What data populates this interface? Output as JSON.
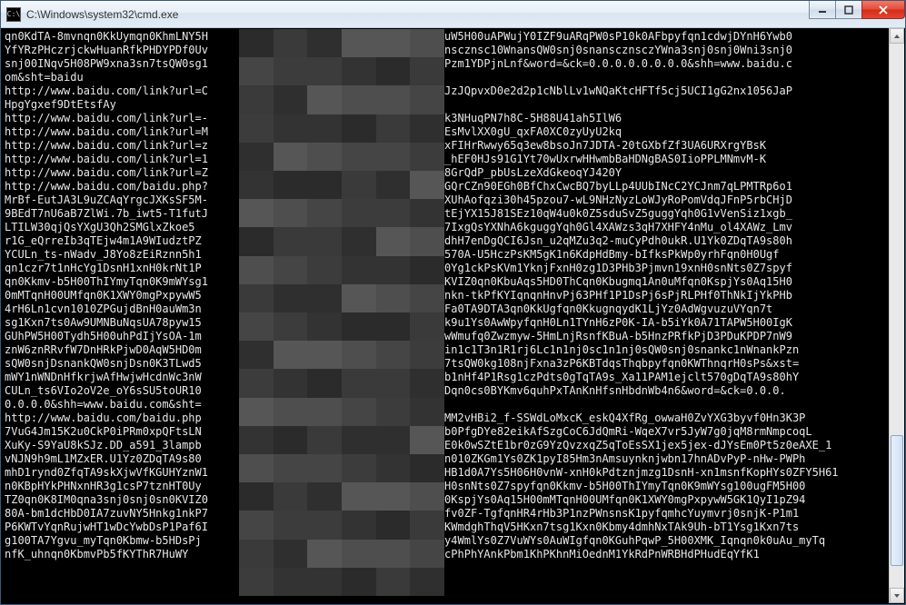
{
  "window": {
    "title": "C:\\Windows\\system32\\cmd.exe",
    "icon_label": "C:\\"
  },
  "controls": {
    "minimize_tip": "Minimize",
    "maximize_tip": "Maximize",
    "close_tip": "Close"
  },
  "console": {
    "lines": [
      "qn0KdTA-8mvnqn0KkUymqn0KhmLNY5H                              5HD0UAuW5H00uAPWujY0IZF9uARqPW0sP10k0AFbpyfqn1cdwjDYnH6Ywb0",
      "YfYRzPHczrjckwHuanRfkPHDYPDf0Uv                              TZfqnanscznsc10WnansQW0snj0snanscznsczYWna3snj0snj0Wni3snj0",
      "snj00INqv5H08PW9xna3sn7tsQW0sg1                              ujYs0APzm1YDPjnLnf&word=&ck=0.0.0.0.0.0.0.0&shh=www.baidu.c",
      "om&sht=baidu                                                 ",
      "http://www.baidu.com/link?url=C                              5Yvs46JzJQpvxD0e2d2p1cNblLv1wNQaKtcHFTf5cj5UCI1gG2nx1056JaP",
      "HpgYgxef9DtEtsfAy                                            ",
      "http://www.baidu.com/link?url=-                              ddyrYJk3NHuqPN7h8C-5H88U41ah5IlW6",
      "http://www.baidu.com/link?url=M                              JDhk04EsMvlXX0gU_qxFA0XC0zyUyU2kq",
      "http://www.baidu.com/link?url=z                              jMrQ3OxFIHrRwwy65q3ew8bsoJn7JDTA-20tGXbfZf3UA6URXrgYBsK",
      "http://www.baidu.com/link?url=1                              UXtCBP_hEF0HJs91G1Yt70wUxrwHHwmbBaHDNgBAS0IioPPLMNmvM-K",
      "http://www.baidu.com/link?url=Z                              y_cVgN8GrQdP_pbUsLzeXdGkeoqYJ420Y",
      "http://www.baidu.com/baidu.php?                              UHTruuGQrCZn90EGh0BfChxCwcBQ7byLLp4UUbINcC2YCJnm7qLPMTRp6o1",
      "MrBf-EutJA3L9uZCAqYrgcJXKsSF5M-                              osaJJRXUhAofqzi30h45pzou7-wL9NHzNyzLoWJyRoPomVdqJFnP5rbCHjD",
      "9BEdT7nU6aB7ZlWi.7b_iwt5-T1futJ                              qxMSgvtEjYX15J81SEz10qW4u0k0Z5sduSvZ5guggYqh0G1vVenSiz1xgb_",
      "LTILW30qjQsYXgU3Qh2SMGlxZkoe5                                9Ct_PH7IxgQsYXNhA6kguggYqh0Gl4XAWzs3qH7XHFY4nMu_ol4XAWz_Lmv",
      "r1G_eQrreIb3qTEjw4m1A9WIudztPZ                               _MzqEQdhH7enDgQCI6Jsn_u2qMZu3q2-muCyPdh0ukR.U1Yk0ZDqTA9s80h",
      "YCULn_ts-nWadv_J8Yo8zEiRznn5h1                               1ejclt570A-U5HczPsKM5gK1n6KdpHdBmy-bIfksPkWp0yrhFqn0H0Ugf",
      "qn1czr7t1nHcYg1DsnH1xnH0krNt1P                               PH9xnW0Yg1ckPsKVm1YknjFxnH0zg1D3PHb3Pjmvn19xnH0snNts0Z7spyf",
      "qn0Kkmv-b5H00ThIYmyTqn0K9mWYsg1                              nj0sn0KVIZ0qn0KbuAqs5HD0ThCqn0Kbugmq1An0uMfqn0KspjYs0Aq15H0",
      "0mMTqnH00UMfqn0K1XWY0mgPxpywW5                               5Hnkg1nkn-tkPfKYIqnqnHnvPj63PHf1P1DsPj6sPjRLPHf0ThNkIjYkPHb",
      "4rH6Ln1cvn1010ZPGujdBnH0auWm3n                               fH0LnYFa0TA9DTA3qn0KkUgfqn0KkugnqydK1LjYz0AdWgvuzuVYqn7t",
      "sg1Kxn7ts0Aw9UMNBuNqsUA78pyw15                               mgwxuhk9u1Ys0AwWpyfqnH0Ln1TYnH6zP0K-IA-b5iYk0A71TAPW5H00IgK",
      "GUhPW5H00Tydh5H00uhPdIjYsOA-1m                               m1Ys0AwWmufq0Zwzmyw-5HmLnjRsnfKBuA-b5HnzPRfkPjD3PDuKPDP7nW9",
      "znW6znRRvfW7DnHRkPjwD0AqW5HD0m                               Wnankrin1c1T3n1R1rj6Lc1n1nj0sc1n1nj0sQW0snj0snankc1nWnankPzn",
      "sQW0snjDsnankQW0snjDsn0K3TLwd5                               xna3sn7tsQW0kg108njFxna3zP6KBTdqsThqbpyfqn0KWThnqrH0sPs&xst=",
      "mWY1nWNDnHfkrjwAfHwjwHcdnWc3nW                               nHmzrjb1nHf4P1Rsg1czPdts0gTqTA9s_Xa11PAM1ejclt570gDqTA9s80hY",
      "CULn_ts6VIo2oV2e_oY6sSU5toUR10                               1wmKUgDqn0cs0BYKmv6quhPxTAnKnHfsnHbdnWb4n6&word=&ck=0.0.0.",
      "0.0.0.0&shh=www.baidu.com&sht=                               ",
      "http://www.baidu.com/baidu.php                               -1JH7WMM2vHBi2_f-SSWdLoMxcK_eskQ4XfRg_owwaH0ZvYXG3byvf0Hn3K3P",
      "7VuG4Jm15K2u0CkP0iPRm0xpQFtsLN                               Dexhjxb0PfgDYe82eikAfSzgCoC6JdQmRi-WqeX7vr5JyW7g0jqM8rmNmpcoqL",
      "XuKy-S9YaU8kSJz.DD_a591_3lampb                               djdJYqE0k0wSZtE1br0zG9YzQvzxqZ5qToEsSX1jex5jex-dJYsEm0Pt5z0eAXE_1",
      "vNJN9h9mL1MZxER.U1Yz0ZDqTA9s80                               n102vdn010ZKGm1Ys0ZK1pyI85Hm3nAmsuynknjwbn17hnADvPyP-nHw-PWPh",
      "mhD1rynd0ZfqTA9skXjwVfKGUHYznW1                              0mv-b5HB1d0A7Ys5H06H0vnW-xnH0kPdtznjmzg1DsnH-xn1msnfKopHYs0ZFY5H61",
      "n0KBpHYkPHNxnHR3g1csP7tznHT0Uy                               vnWIxnH0snNts0Z7spyfqn0Kkmv-b5H00ThIYmyTqn0K9mWYsg100ugFM5H00",
      "TZ0qn0K8IM0qna3snj0snj0sn0KVIZ0                              0uMfqn0KspjYs0Aq15H00mMTqnH00UMfqn0K1XWY0mgPxpywW5GK1QyI1pZ94",
      "80A-bm1dcHbD0IA7zuvNY5Hnkg1nkP7                              rjR3PHfv0ZF-TgfqnHR4rHb3P1nzPWnsnsK1pyfqmhcYuymvrj0snjK-P1m1",
      "P6KWTvYqnRujwHT1wDcYwbDsP1Paf6I                              XHYqn0KWmdghThqV5HKxn7tsg1Kxn0Kbmy4dmhNxTAk9Uh-bT1Ysg1Kxn7ts",
      "g100TA7Ygvu_myTqn0Kbmw-b5HDsPj                               s0ZNspy4WmlYs0Z7VuWYs0AuWIgfqn0KGuhPqwP_5H00XMK_Iqnqn0k0uAu_myTq",
      "nfK_uhnqn0KbmvPb5fKYThR7HuWY                                 nAmAnWcPhPhYAnkPbm1KhPKhnMiOednM1YkRdPnWRBHdPHudEqYfK1"
    ]
  }
}
